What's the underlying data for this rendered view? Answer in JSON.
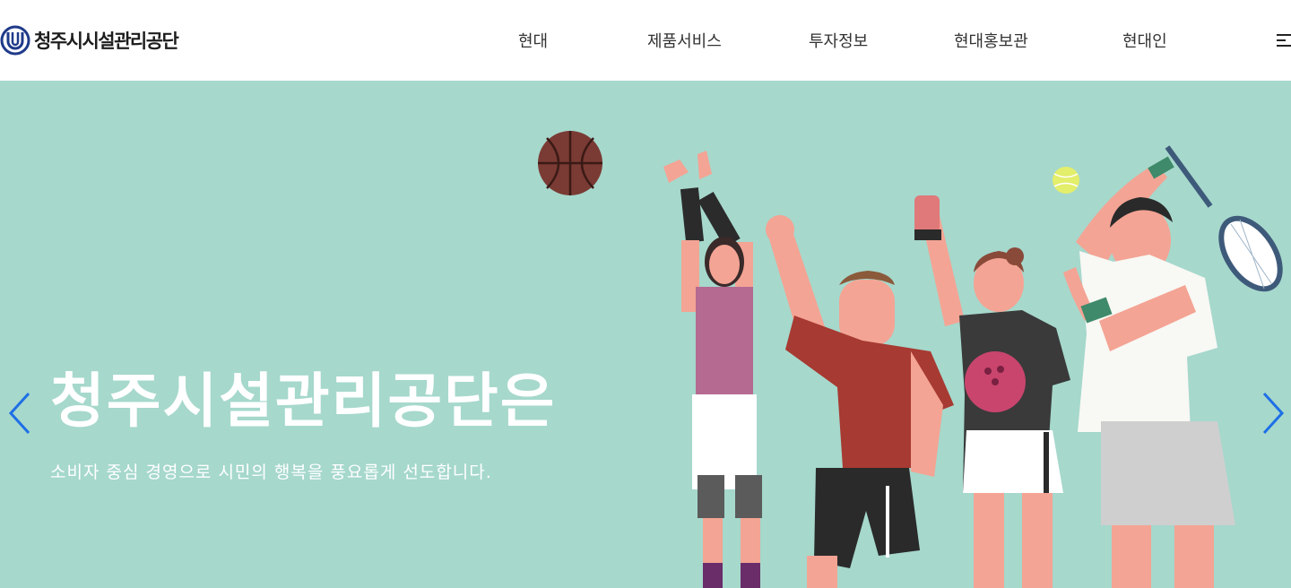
{
  "header": {
    "logo_text": "청주시시설관리공단",
    "nav": [
      {
        "label": "현대"
      },
      {
        "label": "제품서비스"
      },
      {
        "label": "투자정보"
      },
      {
        "label": "현대홍보관"
      },
      {
        "label": "현대인"
      }
    ],
    "menu_icon": "hamburger-icon"
  },
  "hero": {
    "title": "청주시설관리공단은",
    "subtitle": "소비자 중심 경영으로 시민의 행복을 풍요롭게 선도합니다.",
    "background_color": "#a6d8cc",
    "prev_icon": "chevron-left-icon",
    "next_icon": "chevron-right-icon",
    "illustration": "sports-players-illustration"
  },
  "colors": {
    "logo_blue": "#1f3a8a",
    "arrow_blue": "#1e6fe6",
    "hero_bg": "#a6d8cc"
  }
}
